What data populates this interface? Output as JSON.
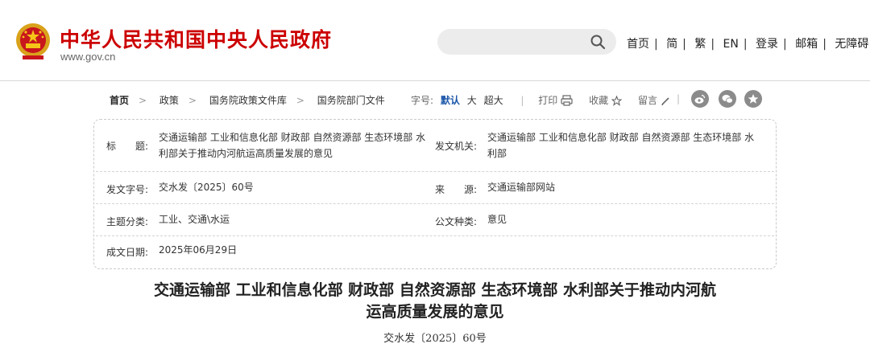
{
  "header": {
    "site_title": "中华人民共和国中央人民政府",
    "site_url": "www.gov.cn",
    "search_placeholder": "",
    "links": [
      "首页",
      "简",
      "繁",
      "EN",
      "登录",
      "邮箱",
      "无障碍"
    ]
  },
  "breadcrumb": [
    "首页",
    "政策",
    "国务院政策文件库",
    "国务院部门文件"
  ],
  "font_size": {
    "label": "字号:",
    "options": [
      "默认",
      "大",
      "超大"
    ],
    "selected": "默认"
  },
  "tools": {
    "print": "打印",
    "favorite": "收藏",
    "comment": "留言"
  },
  "share_icons": [
    "weibo-icon",
    "wechat-icon",
    "favorite-star-icon"
  ],
  "info": {
    "title_label": "标　　题:",
    "title_value": "交通运输部 工业和信息化部 财政部 自然资源部 生态环境部 水利部关于推动内河航运高质量发展的意见",
    "issuer_label": "发文机关:",
    "issuer_value": "交通运输部 工业和信息化部 财政部 自然资源部 生态环境部 水利部",
    "docno_label": "发文字号:",
    "docno_value": "交水发〔2025〕60号",
    "source_label": "来　　源:",
    "source_value": "交通运输部网站",
    "topic_label": "主题分类:",
    "topic_value": "工业、交通\\水运",
    "type_label": "公文种类:",
    "type_value": "意见",
    "date_label": "成文日期:",
    "date_value": "2025年06月29日"
  },
  "document": {
    "title_line1": "交通运输部 工业和信息化部 财政部 自然资源部 生态环境部 水利部关于推动内河航",
    "title_line2": "运高质量发展的意见",
    "number": "交水发〔2025〕60号"
  },
  "colors": {
    "brand_red": "#cc0000",
    "accent_blue": "#1a56a8"
  }
}
